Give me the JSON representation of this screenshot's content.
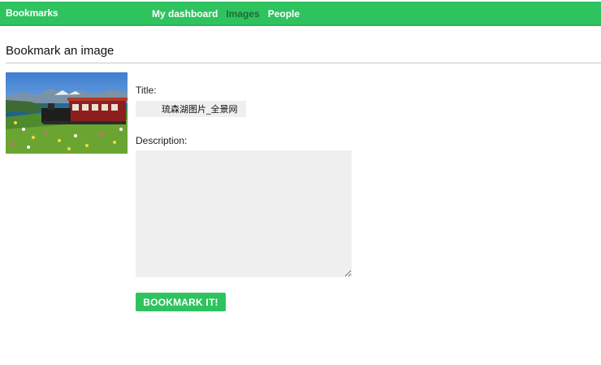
{
  "header": {
    "brand": "Bookmarks",
    "nav": [
      {
        "label": "My dashboard",
        "active": false
      },
      {
        "label": "Images",
        "active": true
      },
      {
        "label": "People",
        "active": false
      }
    ],
    "accent_color": "#2ec35f",
    "active_nav_color": "#1f6b37"
  },
  "page": {
    "title": "Bookmark an image"
  },
  "form": {
    "title_label": "Title:",
    "title_value": "琉森湖图片_全景网",
    "description_label": "Description:",
    "description_value": "",
    "submit_label": "BOOKMARK IT!"
  }
}
